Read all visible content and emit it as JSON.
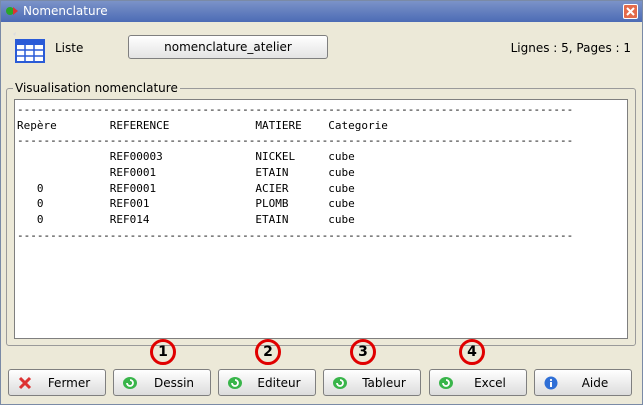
{
  "window": {
    "title": "Nomenclature",
    "icon": "app-icon"
  },
  "header": {
    "list_label": "Liste",
    "list_button_label": "nomenclature_atelier",
    "page_info": "Lignes : 5,  Pages : 1"
  },
  "group": {
    "legend": "Visualisation nomenclature"
  },
  "report": {
    "separator": "------------------------------------------------------------------------------------",
    "columns": [
      "Repère",
      "REFERENCE",
      "MATIERE",
      "Categorie"
    ],
    "rows": [
      {
        "repere": "",
        "reference": "REF00003",
        "matiere": "NICKEL",
        "categorie": "cube"
      },
      {
        "repere": "",
        "reference": "REF0001",
        "matiere": "ETAIN",
        "categorie": "cube"
      },
      {
        "repere": "0",
        "reference": "REF0001",
        "matiere": "ACIER",
        "categorie": "cube"
      },
      {
        "repere": "0",
        "reference": "REF001",
        "matiere": "PLOMB",
        "categorie": "cube"
      },
      {
        "repere": "0",
        "reference": "REF014",
        "matiere": "ETAIN",
        "categorie": "cube"
      }
    ]
  },
  "buttons": {
    "fermer": "Fermer",
    "dessin": "Dessin",
    "editeur": "Editeur",
    "tableur": "Tableur",
    "excel": "Excel",
    "aide": "Aide"
  },
  "markers": [
    "1",
    "2",
    "3",
    "4"
  ],
  "colors": {
    "marker_red": "#e00000",
    "title_blue": "#4c6bb5"
  }
}
